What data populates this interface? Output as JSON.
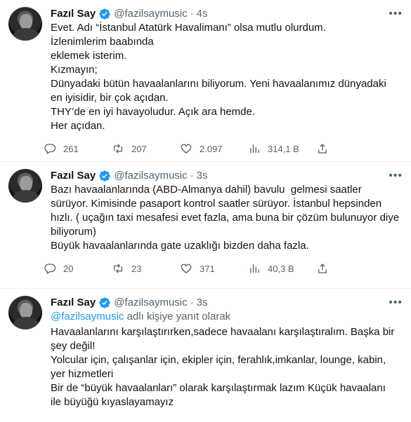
{
  "tweets": [
    {
      "name": "Fazıl Say",
      "handle": "@fazilsaymusic",
      "dot": "·",
      "time": "4s",
      "lines": [
        "Evet. Adı “İstanbul Atatürk Havalimanı” olsa mutlu olurdum.",
        "İzlenimlerim baabında",
        "eklemek isterim.",
        "Kızmayın;",
        "Dünyadaki bütün havaalanlarını biliyorum. Yeni havaalanımız dünyadaki",
        "en iyisidir, bir çok açıdan.",
        "THY’de en iyi havayoludur. Açık ara hemde.",
        "Her açıdan."
      ],
      "stats": {
        "replies": "261",
        "retweets": "207",
        "likes": "2.097",
        "views": "314,1 B"
      }
    },
    {
      "name": "Fazıl Say",
      "handle": "@fazilsaymusic",
      "dot": "·",
      "time": "3s",
      "lines": [
        "Bazı havaalanlarında (ABD-Almanya dahil) bavulu  gelmesi saatler",
        "sürüyor. Kimisinde pasaport kontrol saatler sürüyor. İstanbul hepsinden",
        "hızlı. ( uçağın taxi mesafesi evet fazla, ama buna bir çözüm bulunuyor diye",
        "biliyorum)",
        "Büyük havaalanlarında gate uzaklığı bizden daha fazla."
      ],
      "stats": {
        "replies": "20",
        "retweets": "23",
        "likes": "371",
        "views": "40,3 B"
      }
    },
    {
      "name": "Fazıl Say",
      "handle": "@fazilsaymusic",
      "dot": "·",
      "time": "3s",
      "reply_mention": "@fazilsaymusic",
      "reply_suffix": " adlı kişiye yanıt olarak",
      "lines": [
        "Havaalanlarını karşılaştırırken,sadece havaalanı karşılaştıralım. Başka bir",
        "şey değil!",
        "Yolcular için, çalışanlar için, ekipler için, ferahlık,imkanlar, lounge, kabin,",
        "yer hizmetleri",
        "Bir de “büyük havaalanları” olarak karşılaştırmak lazım Küçük havaalanı",
        "ile büyüğü kıyaslayamayız"
      ]
    }
  ],
  "icons": {
    "reply": "reply-icon",
    "retweet": "retweet-icon",
    "like": "heart-icon",
    "views": "views-icon",
    "share": "share-icon",
    "verified": "verified-badge-icon",
    "more": "more-icon"
  },
  "colors": {
    "verified": "#1d9bf0",
    "mention": "#1d9bf0",
    "secondary_text": "#536471",
    "primary_text": "#0f1419"
  }
}
